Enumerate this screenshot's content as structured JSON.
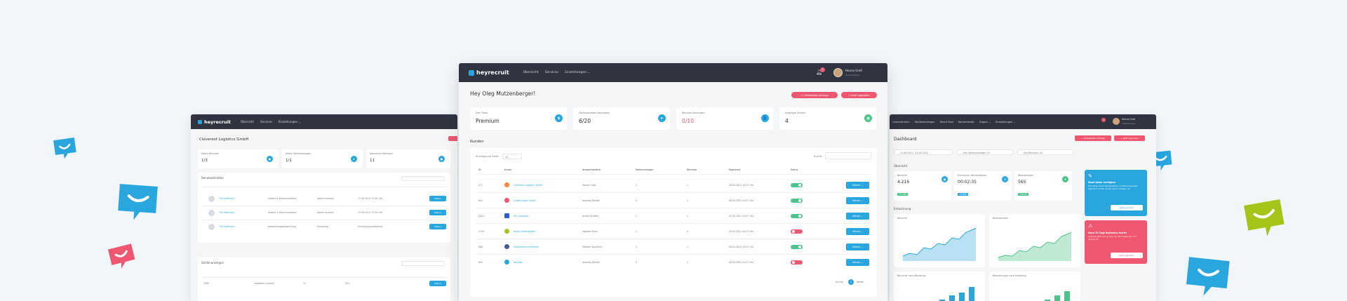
{
  "brand": {
    "logo_text": "heyrecruit"
  },
  "colors": {
    "accent": "#2aa6df",
    "danger": "#ef5670",
    "success": "#4cc38a",
    "nav_bg": "#2f3440",
    "lime": "#a4c41a"
  },
  "center": {
    "nav": [
      "Übersicht",
      "Services",
      "Einstellungen ⌄"
    ],
    "notification_count": "3",
    "user": {
      "name": "Hanna Groß",
      "role": "Administrator"
    },
    "greeting": "Hey Oleg Mutzenberger!",
    "buttons": {
      "primary": "+ Unbesetzte Anfrage",
      "secondary": "+ Jetzt upgraden"
    },
    "stats": [
      {
        "label": "Dein Paket",
        "value": "Premium",
        "icon": "$",
        "color": "#2aa6df",
        "value_color": "#333"
      },
      {
        "label": "Stellenanzeigen Kontingent",
        "value": "6/20",
        "icon": "➤",
        "color": "#2aa6df",
        "value_color": "#333"
      },
      {
        "label": "Benutzer Kontingent",
        "value": "0/10",
        "icon": "👤",
        "color": "#2aa6df",
        "value_color": "#ef5670"
      },
      {
        "label": "Angelegte Kunden",
        "value": "4",
        "icon": "▣",
        "color": "#4cc38a",
        "value_color": "#333"
      }
    ],
    "customers": {
      "title": "Kunden",
      "page_size_label": "Einträge pro Seite",
      "page_size": "10",
      "search_label": "Suche:",
      "columns": [
        "ID",
        "Kunde",
        "Ansprechpartner",
        "Stellenanzeigen",
        "Benutzer",
        "Registriert",
        "Status",
        ""
      ],
      "rows": [
        {
          "id": "471",
          "name": "Cleverest Logistics GmbH",
          "contact": "Hanna Groß",
          "ads": "1",
          "users": "1",
          "date": "16.02.2021 10:07 Uhr",
          "active": true,
          "logo_color": "#f08a3a"
        },
        {
          "id": "601",
          "name": "Quality Solar GmbH",
          "contact": "Andreas Palmer",
          "ads": "0",
          "users": "1",
          "date": "06.02.2021 10:07 Uhr",
          "active": true,
          "logo_color": "#ef5670"
        },
        {
          "id": "2224",
          "name": "GS Computer",
          "contact": "Ankita Schäfer",
          "ads": "1",
          "users": "1",
          "date": "07.02.2021 10:07 Uhr",
          "active": true,
          "logo_color": "#2a62c8"
        },
        {
          "id": "1703",
          "name": "Anton Gartenarbeit",
          "contact": "Isabella Stock",
          "ads": "1",
          "users": "4",
          "date": "05.02.2021 10:07 Uhr",
          "active": false,
          "logo_color": "#a4c41a"
        },
        {
          "id": "668",
          "name": "Kinderwelt und Partner",
          "contact": "Michael Sonnbuck",
          "ads": "1",
          "users": "1",
          "date": "06.02.2021 10:07 Uhr",
          "active": true,
          "logo_color": "#455a8c"
        },
        {
          "id": "605",
          "name": "Youtube",
          "contact": "Andreas Palmer",
          "ads": "0",
          "users": "1",
          "date": "06.02.2021 10:07 Uhr",
          "active": false,
          "logo_color": "#2aa6df"
        }
      ],
      "action_label": "Aktion ⌄",
      "pagination": {
        "prev": "Zurück",
        "page": "1",
        "next": "Weiter"
      }
    }
  },
  "left": {
    "nav": [
      "Übersicht",
      "Services",
      "Einstellungen ⌄"
    ],
    "company": "Cleverest Logistics GmbH",
    "stats": [
      {
        "label": "Aktive Benutzer",
        "value": "1/3"
      },
      {
        "label": "Aktive Stellenanzeigen",
        "value": "1/1"
      },
      {
        "label": "Abonnierte Benutzer",
        "value": "11"
      }
    ],
    "users_title": "Benutzerkonten",
    "users": [
      {
        "name": "Tim Hoffmann",
        "role": "Kreativ & Kommunikation",
        "status": "admin account",
        "date": "17.09.2021 17:00 Uhr"
      },
      {
        "name": "Tim Hoffmann",
        "role": "Kreativ & Kommunikation",
        "status": "admin account",
        "date": "17.09.2021 17:00 Uhr"
      },
      {
        "name": "Tim Hoffmann",
        "role": "Anwendungsentwicklung",
        "status": "Einladung",
        "date": "Einladung ausstehend"
      }
    ],
    "ads_title": "Stellenanzeigen",
    "ad_row": {
      "id": "1395",
      "name": "Logistiker (m/w/d)",
      "count": "17",
      "users": "204"
    },
    "action_label": "Aktion"
  },
  "right": {
    "nav": [
      "Unternehmen",
      "Stellenanzeigen",
      "Talent Pool",
      "Karriereseite",
      "Fragen ⌄",
      "Einstellungen ⌄"
    ],
    "user": {
      "name": "Hanna Groß",
      "role": "Administrator"
    },
    "title": "Dashboard",
    "buttons": {
      "primary": "+ Unbesetzte Anfrage",
      "secondary": "+ Jetzt upgraden"
    },
    "filters": [
      "01.06.2021 - 31.06.2021",
      "Alle Stellenanzeigen (4)",
      "Alle Benutzer (4)"
    ],
    "overview_title": "Übersicht",
    "kpis": [
      {
        "label": "Besuche",
        "value": "4.216",
        "delta": "+7.4%"
      },
      {
        "label": "Durchschn. Besuchsdauer",
        "value": "00:02:35",
        "delta": "+0.6%"
      },
      {
        "label": "Bewerbungen",
        "value": "565",
        "delta": "+8.1%"
      }
    ],
    "promo_blue": {
      "title": "Neue Ideen verfügbar",
      "text": "Wir haben deine Karriereseite und Stellenanzeigen optimiert. Schau dir die neuen Vorlagen an.",
      "cta": "Jetzt ansehen"
    },
    "promo_red": {
      "title": "Noch 30 Tage kostenlos testen",
      "text": "Upgrade jetzt und sichere dir alle Funktionen von heyrecruit.",
      "cta": "Jetzt upgraden"
    },
    "development_title": "Entwicklung",
    "chart_left_title": "Besuche",
    "chart_right_title": "Bewerbungen",
    "bottom_left_title": "Besucher nach Marketing",
    "bottom_right_title": "Bewerbungen nach Marketing"
  }
}
